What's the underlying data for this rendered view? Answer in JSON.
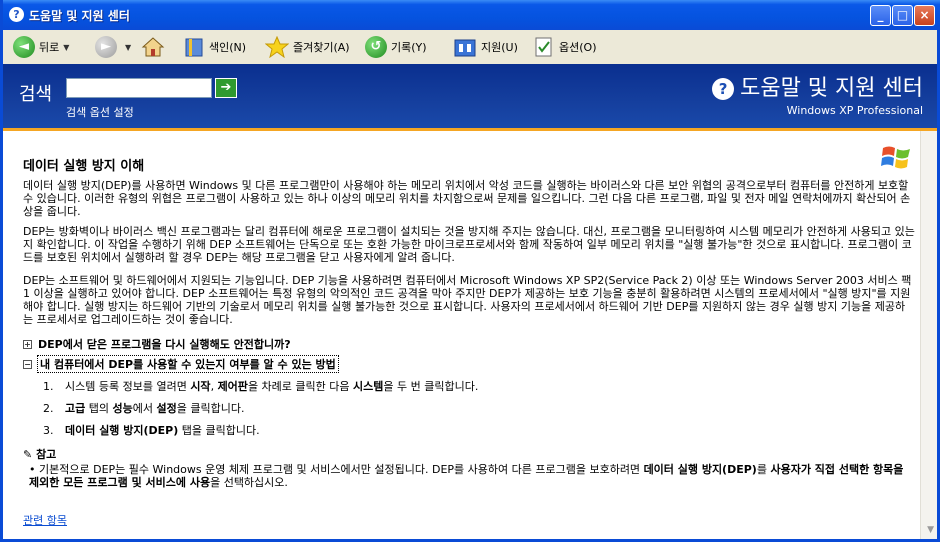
{
  "window": {
    "title": "도움말 및 지원 센터"
  },
  "toolbar": {
    "back": "뒤로",
    "index": "색인(N)",
    "favorites": "즐겨찾기(A)",
    "history": "기록(Y)",
    "support": "지원(U)",
    "options": "옵션(O)"
  },
  "search": {
    "label": "검색",
    "placeholder": "",
    "options_link": "검색 옵션 설정",
    "help_center": "도움말 및 지원 센터",
    "product": "Windows XP Professional"
  },
  "article": {
    "title": "데이터 실행 방지 이해",
    "p1": "데이터 실행 방지(DEP)를 사용하면 Windows 및 다른 프로그램만이 사용해야 하는 메모리 위치에서 악성 코드를 실행하는 바이러스와 다른 보안 위협의 공격으로부터 컴퓨터를 안전하게 보호할 수 있습니다. 이러한 유형의 위협은 프로그램이 사용하고 있는 하나 이상의 메모리 위치를 차지함으로써 문제를 일으킵니다. 그런 다음 다른 프로그램, 파일 및 전자 메일 연락처에까지 확산되어 손상을 줍니다.",
    "p2": "DEP는 방화벽이나 바이러스 백신 프로그램과는 달리 컴퓨터에 해로운 프로그램이 설치되는 것을 방지해 주지는 않습니다. 대신, 프로그램을 모니터링하여 시스템 메모리가 안전하게 사용되고 있는지 확인합니다. 이 작업을 수행하기 위해 DEP 소프트웨어는 단독으로 또는 호환 가능한 마이크로프로세서와 함께 작동하여 일부 메모리 위치를 \"실행 불가능\"한 것으로 표시합니다. 프로그램이 코드를 보호된 위치에서 실행하려 할 경우 DEP는 해당 프로그램을 닫고 사용자에게 알려 줍니다.",
    "p3": "DEP는 소프트웨어 및 하드웨어에서 지원되는 기능입니다. DEP 기능을 사용하려면 컴퓨터에서 Microsoft Windows XP SP2(Service Pack 2) 이상 또는 Windows Server 2003 서비스 팩 1 이상을 실행하고 있어야 합니다. DEP 소프트웨어는 특정 유형의 악의적인 코드 공격을 막아 주지만 DEP가 제공하는 보호 기능을 충분히 활용하려면 시스템의 프로세서에서 \"실행 방지\"를 지원해야 합니다. 실행 방지는 하드웨어 기반의 기술로서 메모리 위치를 실행 불가능한 것으로 표시합니다. 사용자의 프로세서에서 하드웨어 기반 DEP를 지원하지 않는 경우 실행 방지 기능을 제공하는 프로세서로 업그레이드하는 것이 좋습니다.",
    "expand1": "DEP에서 닫은 프로그램을 다시 실행해도 안전합니까?",
    "expand2": "내 컴퓨터에서 DEP를 사용할 수 있는지 여부를 알 수 있는 방법",
    "steps": [
      {
        "n": "1.",
        "a": "시스템 등록 정보를 열려면 ",
        "b1": "시작",
        "c": ", ",
        "b2": "제어판",
        "d": "을 차례로 클릭한 다음 ",
        "b3": "시스템",
        "e": "을 두 번 클릭합니다."
      },
      {
        "n": "2.",
        "a": "",
        "b1": "고급",
        "c": " 탭의 ",
        "b2": "성능",
        "d": "에서 ",
        "b3": "설정",
        "e": "을 클릭합니다."
      },
      {
        "n": "3.",
        "a": "",
        "b1": "데이터 실행 방지(DEP)",
        "c": " 탭을 클릭합니다.",
        "b2": "",
        "d": "",
        "b3": "",
        "e": ""
      }
    ],
    "note_title": "참고",
    "note_a": "기본적으로 DEP는 필수 Windows 운영 체제 프로그램 및 서비스에서만 설정됩니다. DEP를 사용하여 다른 프로그램을 보호하려면 ",
    "note_b": "데이터 실행 방지(DEP)",
    "note_c": "를 ",
    "note_d": "사용자가 직접 선택한 항목을 제외한 모든 프로그램 및 서비스에 사용",
    "note_e": "을 선택하십시오.",
    "related": "관련 항목"
  },
  "colors": {
    "accent": "#0a4bd6",
    "orange_rule": "#f5a623",
    "link": "#0b4cd1"
  }
}
